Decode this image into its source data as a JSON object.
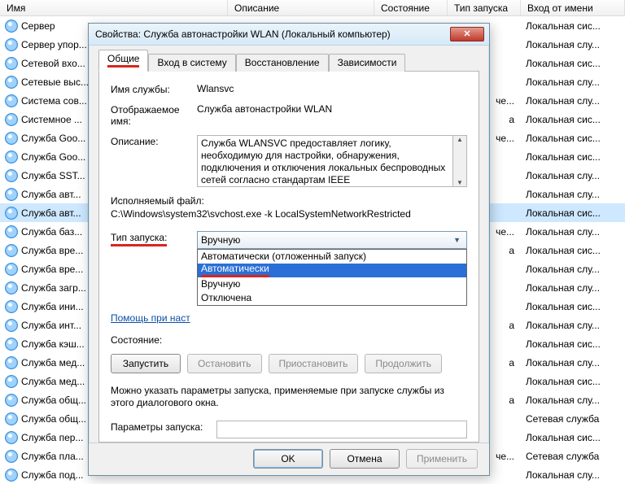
{
  "columns": {
    "name": "Имя",
    "desc": "Описание",
    "state": "Состояние",
    "start": "Тип запуска",
    "logon": "Вход от имени"
  },
  "rows": [
    {
      "name": "Сервер",
      "logon": "Локальная сис..."
    },
    {
      "name": "Сервер упор...",
      "logon": "Локальная слу..."
    },
    {
      "name": "Сетевой вхо...",
      "logon": "Локальная сис..."
    },
    {
      "name": "Сетевые выс...",
      "logon": "Локальная слу..."
    },
    {
      "name": "Система сов...",
      "logon": "Локальная слу...",
      "tail": "че..."
    },
    {
      "name": "Системное ...",
      "logon": "Локальная сис...",
      "tail": "а"
    },
    {
      "name": "Служба Goo...",
      "logon": "Локальная сис...",
      "tail": "че..."
    },
    {
      "name": "Служба Goo...",
      "logon": "Локальная сис..."
    },
    {
      "name": "Служба SST...",
      "logon": "Локальная слу..."
    },
    {
      "name": "Служба авт...",
      "logon": "Локальная слу..."
    },
    {
      "name": "Служба авт...",
      "logon": "Локальная сис...",
      "selected": true
    },
    {
      "name": "Служба баз...",
      "logon": "Локальная слу...",
      "tail": "че..."
    },
    {
      "name": "Служба вре...",
      "logon": "Локальная сис...",
      "tail": "а"
    },
    {
      "name": "Служба вре...",
      "logon": "Локальная слу..."
    },
    {
      "name": "Служба загр...",
      "logon": "Локальная слу..."
    },
    {
      "name": "Служба ини...",
      "logon": "Локальная сис..."
    },
    {
      "name": "Служба инт...",
      "logon": "Локальная слу...",
      "tail": "а"
    },
    {
      "name": "Служба кэш...",
      "logon": "Локальная сис..."
    },
    {
      "name": "Служба мед...",
      "logon": "Локальная слу...",
      "tail": "а"
    },
    {
      "name": "Служба мед...",
      "logon": "Локальная сис..."
    },
    {
      "name": "Служба общ...",
      "logon": "Локальная слу...",
      "tail": "а"
    },
    {
      "name": "Служба общ...",
      "logon": "Сетевая служба"
    },
    {
      "name": "Служба пер...",
      "logon": "Локальная сис..."
    },
    {
      "name": "Служба пла...",
      "logon": "Сетевая служба",
      "tail": "че..."
    },
    {
      "name": "Служба под...",
      "logon": "Локальная слу..."
    }
  ],
  "dialog": {
    "title": "Свойства: Служба автонастройки WLAN (Локальный компьютер)",
    "close": "✕",
    "tabs": {
      "general": "Общие",
      "logon": "Вход в систему",
      "recovery": "Восстановление",
      "deps": "Зависимости"
    },
    "labels": {
      "svc_name": "Имя службы:",
      "disp_name": "Отображаемое имя:",
      "desc": "Описание:",
      "exe": "Исполняемый файл:",
      "startup": "Тип запуска:",
      "help": "Помощь при наст",
      "state": "Состояние:",
      "note": "Можно указать параметры запуска, применяемые при запуске службы из этого диалогового окна.",
      "params": "Параметры запуска:"
    },
    "values": {
      "svc_name": "Wlansvc",
      "disp_name": "Служба автонастройки WLAN",
      "desc": "Служба WLANSVC предоставляет логику, необходимую для настройки, обнаружения, подключения и отключения локальных беспроводных сетей согласно стандартам IEEE",
      "exe": "C:\\Windows\\system32\\svchost.exe -k LocalSystemNetworkRestricted",
      "startup_current": "Вручную"
    },
    "startup_options": {
      "o0": "Автоматически (отложенный запуск)",
      "o1": "Автоматически",
      "o2": "Вручную",
      "o3": "Отключена"
    },
    "buttons": {
      "start": "Запустить",
      "stop": "Остановить",
      "pause": "Приостановить",
      "resume": "Продолжить",
      "ok": "OK",
      "cancel": "Отмена",
      "apply": "Применить"
    }
  }
}
